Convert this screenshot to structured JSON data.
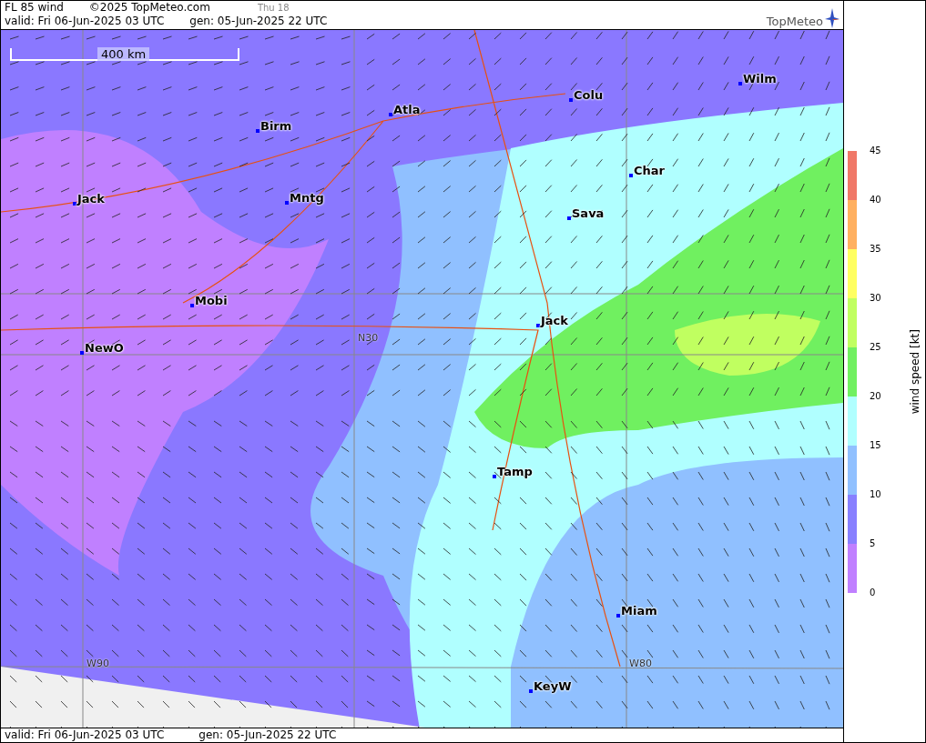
{
  "header": {
    "title": "FL 85 wind",
    "copyright": "©2025 TopMeteo.com",
    "time_step": "Thu 18",
    "valid": "valid:  Fri  06-Jun-2025  03 UTC",
    "generated": "gen: 05-Jun-2025 22 UTC",
    "logo": "TopMeteo"
  },
  "map": {
    "scale_label": "400 km",
    "grid_labels": [
      "N30",
      "W90",
      "W80"
    ],
    "cities": [
      {
        "name": "Colu"
      },
      {
        "name": "Wilm"
      },
      {
        "name": "Atla"
      },
      {
        "name": "Birm"
      },
      {
        "name": "Jack"
      },
      {
        "name": "Mntg"
      },
      {
        "name": "Char"
      },
      {
        "name": "Sava"
      },
      {
        "name": "Mobi"
      },
      {
        "name": "Jack"
      },
      {
        "name": "NewO"
      },
      {
        "name": "Tamp"
      },
      {
        "name": "Miam"
      },
      {
        "name": "KeyW"
      }
    ]
  },
  "legend": {
    "title": "wind speed [kt]",
    "segments": [
      {
        "color": "#f07868"
      },
      {
        "color": "#ffb060"
      },
      {
        "color": "#ffff60"
      },
      {
        "color": "#c0ff60"
      },
      {
        "color": "#70f060"
      },
      {
        "color": "#b0ffff"
      },
      {
        "color": "#90c0ff"
      },
      {
        "color": "#8880ff"
      },
      {
        "color": "#c080ff"
      }
    ],
    "ticks": [
      "45",
      "40",
      "35",
      "30",
      "25",
      "20",
      "15",
      "10",
      "5",
      "0"
    ]
  },
  "footer": {
    "valid": "valid:  Fri  06-Jun-2025  03 UTC",
    "generated": "gen: 05-Jun-2025 22 UTC"
  }
}
